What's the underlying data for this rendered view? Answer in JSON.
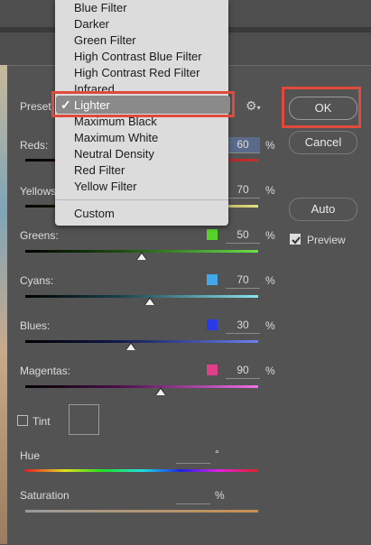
{
  "dialog": {
    "preset_label": "Preset:",
    "preset_value": "Lighter",
    "ok_label": "OK",
    "cancel_label": "Cancel",
    "auto_label": "Auto",
    "preview_label": "Preview",
    "preview_checked": true,
    "tint_label": "Tint",
    "tint_checked": false,
    "hue_label": "Hue",
    "hue_unit": "°",
    "saturation_label": "Saturation",
    "saturation_unit": "%"
  },
  "preset_menu": {
    "items": [
      "Blue Filter",
      "Darker",
      "Green Filter",
      "High Contrast Blue Filter",
      "High Contrast Red Filter",
      "Infrared",
      "Lighter",
      "Maximum Black",
      "Maximum White",
      "Neutral Density",
      "Red Filter",
      "Yellow Filter"
    ],
    "selected": "Lighter",
    "custom_label": "Custom",
    "checkmark": "✓"
  },
  "channels": [
    {
      "label": "Reds:",
      "value": "60",
      "unit": "%",
      "swatch": "#e23a3a"
    },
    {
      "label": "Yellows:",
      "value": "70",
      "unit": "%",
      "swatch": "#e0d23a"
    },
    {
      "label": "Greens:",
      "value": "50",
      "unit": "%",
      "swatch": "#5ad22e",
      "slider": 0.5
    },
    {
      "label": "Cyans:",
      "value": "70",
      "unit": "%",
      "swatch": "#44a8e8",
      "slider": 0.535
    },
    {
      "label": "Blues:",
      "value": "30",
      "unit": "%",
      "swatch": "#2a3ae6",
      "slider": 0.455
    },
    {
      "label": "Magentas:",
      "value": "90",
      "unit": "%",
      "swatch": "#e23f8a",
      "slider": 0.58
    }
  ],
  "colors": {
    "highlight_red": "#e04a3a",
    "menu_bg": "#dcdcdc",
    "dialog_bg": "#535353"
  },
  "icons": {
    "gear": "⚙",
    "dropdown": "▾"
  }
}
